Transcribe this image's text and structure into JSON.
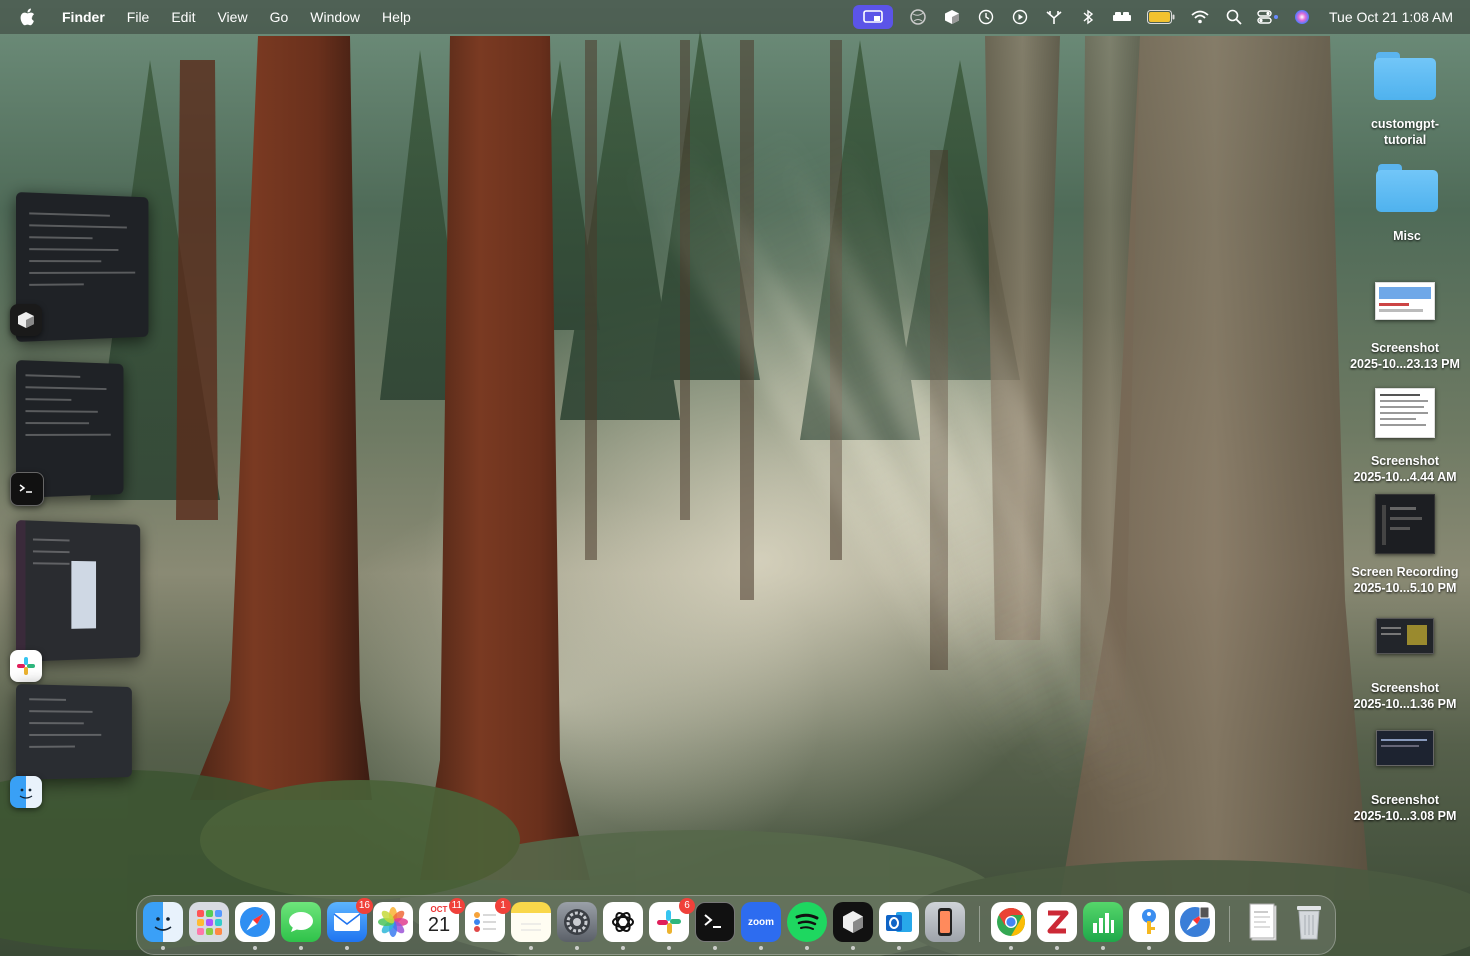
{
  "menubar": {
    "apple": "",
    "app_name": "Finder",
    "menus": [
      "File",
      "Edit",
      "View",
      "Go",
      "Window",
      "Help"
    ],
    "clock": "Tue Oct 21  1:08 AM",
    "status_icons": [
      "screen-share-icon",
      "vpn-globe-icon",
      "cube-icon",
      "time-machine-icon",
      "play-circle-icon",
      "airplay-icon",
      "bluetooth-icon",
      "bed-icon",
      "battery-icon",
      "wifi-icon",
      "spotlight-search-icon",
      "control-center-icon",
      "siri-icon"
    ],
    "accent_color": "#5b54e8"
  },
  "desktop": {
    "items": [
      {
        "type": "folder",
        "label": "customgpt-tutorial",
        "label_lines": [
          "customgpt-",
          "tutorial"
        ]
      },
      {
        "type": "folder",
        "label": "Misc",
        "label_lines": [
          "Misc"
        ]
      },
      {
        "type": "file",
        "label": "Screenshot 2025-10...23.13 PM",
        "label_lines": [
          "Screenshot",
          "2025-10...23.13 PM"
        ]
      },
      {
        "type": "file",
        "label": "Screenshot 2025-10...4.44 AM",
        "label_lines": [
          "Screenshot",
          "2025-10...4.44 AM"
        ]
      },
      {
        "type": "file",
        "label": "Screen Recording 2025-10...5.10 PM",
        "label_lines": [
          "Screen Recording",
          "2025-10...5.10 PM"
        ]
      },
      {
        "type": "file",
        "label": "Screenshot 2025-10...1.36 PM",
        "label_lines": [
          "Screenshot",
          "2025-10...1.36 PM"
        ]
      },
      {
        "type": "file",
        "label": "Screenshot 2025-10...3.08 PM",
        "label_lines": [
          "Screenshot",
          "2025-10...3.08 PM"
        ]
      }
    ]
  },
  "stage_manager": {
    "groups": [
      {
        "app": "Cursor",
        "icon": "cube-app-icon"
      },
      {
        "app": "Terminal",
        "icon": "terminal-icon"
      },
      {
        "app": "Slack",
        "icon": "slack-icon"
      },
      {
        "app": "Finder",
        "icon": "finder-icon"
      }
    ]
  },
  "dock": {
    "apps": [
      {
        "name": "Finder",
        "icon": "finder-icon",
        "running": true
      },
      {
        "name": "Launchpad",
        "icon": "launchpad-icon",
        "running": false
      },
      {
        "name": "Safari",
        "icon": "safari-icon",
        "running": true
      },
      {
        "name": "Messages",
        "icon": "messages-icon",
        "running": true
      },
      {
        "name": "Mail",
        "icon": "mail-icon",
        "running": true,
        "badge": "16"
      },
      {
        "name": "Photos",
        "icon": "photos-icon",
        "running": false
      },
      {
        "name": "Calendar",
        "icon": "calendar-icon",
        "running": false,
        "badge": "11",
        "cal_month": "OCT",
        "cal_day": "21"
      },
      {
        "name": "Reminders",
        "icon": "reminders-icon",
        "running": false,
        "badge": "1"
      },
      {
        "name": "Notes",
        "icon": "notes-icon",
        "running": true
      },
      {
        "name": "System Settings",
        "icon": "settings-gear-icon",
        "running": true
      },
      {
        "name": "ChatGPT",
        "icon": "chatgpt-icon",
        "running": true
      },
      {
        "name": "Slack",
        "icon": "slack-icon",
        "running": true,
        "badge": "6"
      },
      {
        "name": "Terminal",
        "icon": "terminal-icon",
        "running": true
      },
      {
        "name": "Zoom",
        "icon": "zoom-icon",
        "running": true,
        "text": "zoom"
      },
      {
        "name": "Spotify",
        "icon": "spotify-icon",
        "running": true
      },
      {
        "name": "Cursor",
        "icon": "cube-app-icon",
        "running": true
      },
      {
        "name": "Outlook",
        "icon": "outlook-icon",
        "running": true
      },
      {
        "name": "iPhone Mirroring",
        "icon": "iphone-mirroring-icon",
        "running": false
      },
      {
        "name": "Google Chrome",
        "icon": "chrome-icon",
        "running": true
      },
      {
        "name": "Zotero",
        "icon": "zotero-icon",
        "running": true
      },
      {
        "name": "Numbers",
        "icon": "numbers-icon",
        "running": true
      },
      {
        "name": "Passwords",
        "icon": "passwords-key-icon",
        "running": true
      },
      {
        "name": "Safari Technology Preview",
        "icon": "safari-preview-icon",
        "running": false
      },
      {
        "name": "Recent Documents",
        "icon": "document-stack-icon",
        "running": false
      },
      {
        "name": "Trash",
        "icon": "trash-icon",
        "running": false
      }
    ]
  }
}
